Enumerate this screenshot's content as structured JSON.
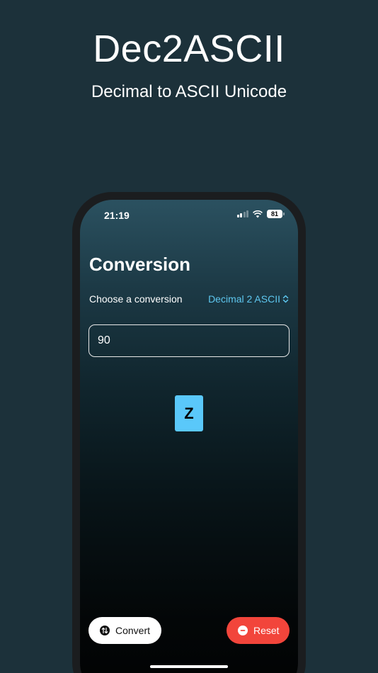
{
  "promo": {
    "title": "Dec2ASCII",
    "subtitle": "Decimal to ASCII Unicode"
  },
  "status_bar": {
    "time": "21:19",
    "battery": "81",
    "icons": [
      "signal-icon",
      "wifi-icon",
      "battery-icon"
    ]
  },
  "screen": {
    "heading": "Conversion",
    "choose_label": "Choose a conversion",
    "picker_value": "Decimal 2 ASCII",
    "input_value": "90",
    "result": "Z"
  },
  "actions": {
    "convert_label": "Convert",
    "reset_label": "Reset"
  },
  "colors": {
    "background": "#1c313a",
    "accent": "#5ec7ef",
    "result_tile": "#5ac8fa",
    "reset": "#f2453b"
  }
}
